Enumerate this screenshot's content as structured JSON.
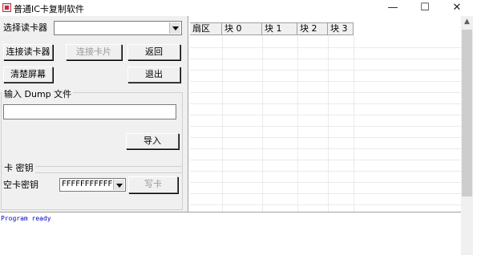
{
  "window": {
    "title": "普通IC卡复制软件",
    "minimize_glyph": "—",
    "maximize_glyph": "☐",
    "close_glyph": "✕"
  },
  "reader": {
    "label": "选择读卡器",
    "selected": ""
  },
  "buttons": {
    "connect_reader": "连接读卡器",
    "connect_card": "连接卡片",
    "back": "返回",
    "clear_screen": "清楚屏幕",
    "exit": "退出",
    "import": "导入",
    "write_card": "写卡"
  },
  "dump_group": {
    "title": "输入 Dump 文件",
    "path_value": ""
  },
  "key_group": {
    "title": "卡 密钥",
    "empty_key_label": "空卡密钥",
    "empty_key_value": "FFFFFFFFFFFF"
  },
  "grid": {
    "columns": [
      "扇区",
      "块 0",
      "块 1",
      "块 2",
      "块 3"
    ]
  },
  "log": {
    "lines": [
      "Program ready"
    ]
  },
  "scrollbar": {
    "up_glyph": "▲"
  }
}
